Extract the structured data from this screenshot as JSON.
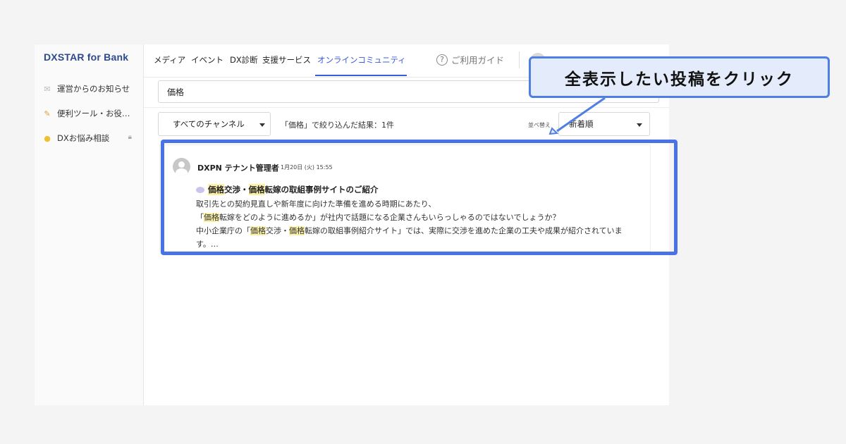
{
  "sidebar": {
    "logo": "DXSTAR for Bank",
    "items": [
      {
        "label": "運営からのお知らせ",
        "icon": "mail-icon"
      },
      {
        "label": "便利ツール・お役…",
        "icon": "memo-icon"
      },
      {
        "label": "DXお悩み相談",
        "icon": "lightbulb-icon",
        "locked": true
      }
    ]
  },
  "topnav": {
    "tabs": [
      {
        "label": "メディア"
      },
      {
        "label": "イベント"
      },
      {
        "label": "DX診断"
      },
      {
        "label": "支援サービス"
      },
      {
        "label": "オンラインコミュニティ",
        "active": true
      }
    ],
    "guide_label": "ご利用ガイド"
  },
  "search": {
    "value": "価格"
  },
  "toolbar": {
    "channel_select": "すべてのチャンネル",
    "result_text": "「価格」で絞り込んだ結果：1件",
    "sort_label": "並べ替え",
    "sort_select": "新着順"
  },
  "post": {
    "author": "DXPN テナント管理者",
    "time": "1月20日 (火) 15:55",
    "title_parts": [
      "価格",
      "交渉・",
      "価格",
      "転嫁の取組事例サイトのご紹介"
    ],
    "line1": "取引先との契約見直しや新年度に向けた準備を進める時期にあたり、",
    "line2_parts": [
      "「",
      "価格",
      "転嫁をどのように進めるか」が社内で話題になる企業さんもいらっしゃるのではないでしょうか？"
    ],
    "line3_parts": [
      "中小企業庁の「",
      "価格",
      "交渉・",
      "価格",
      "転嫁の取組事例紹介サイト」では、実際に交渉を進めた企業の工夫や成果が紹介されていま"
    ],
    "line4": "す。…"
  },
  "annotation": {
    "callout": "全表示したい投稿をクリック"
  },
  "colors": {
    "accent": "#3b5bdb",
    "highlight": "#fbf0a8",
    "overlay": "#4a72e8"
  }
}
